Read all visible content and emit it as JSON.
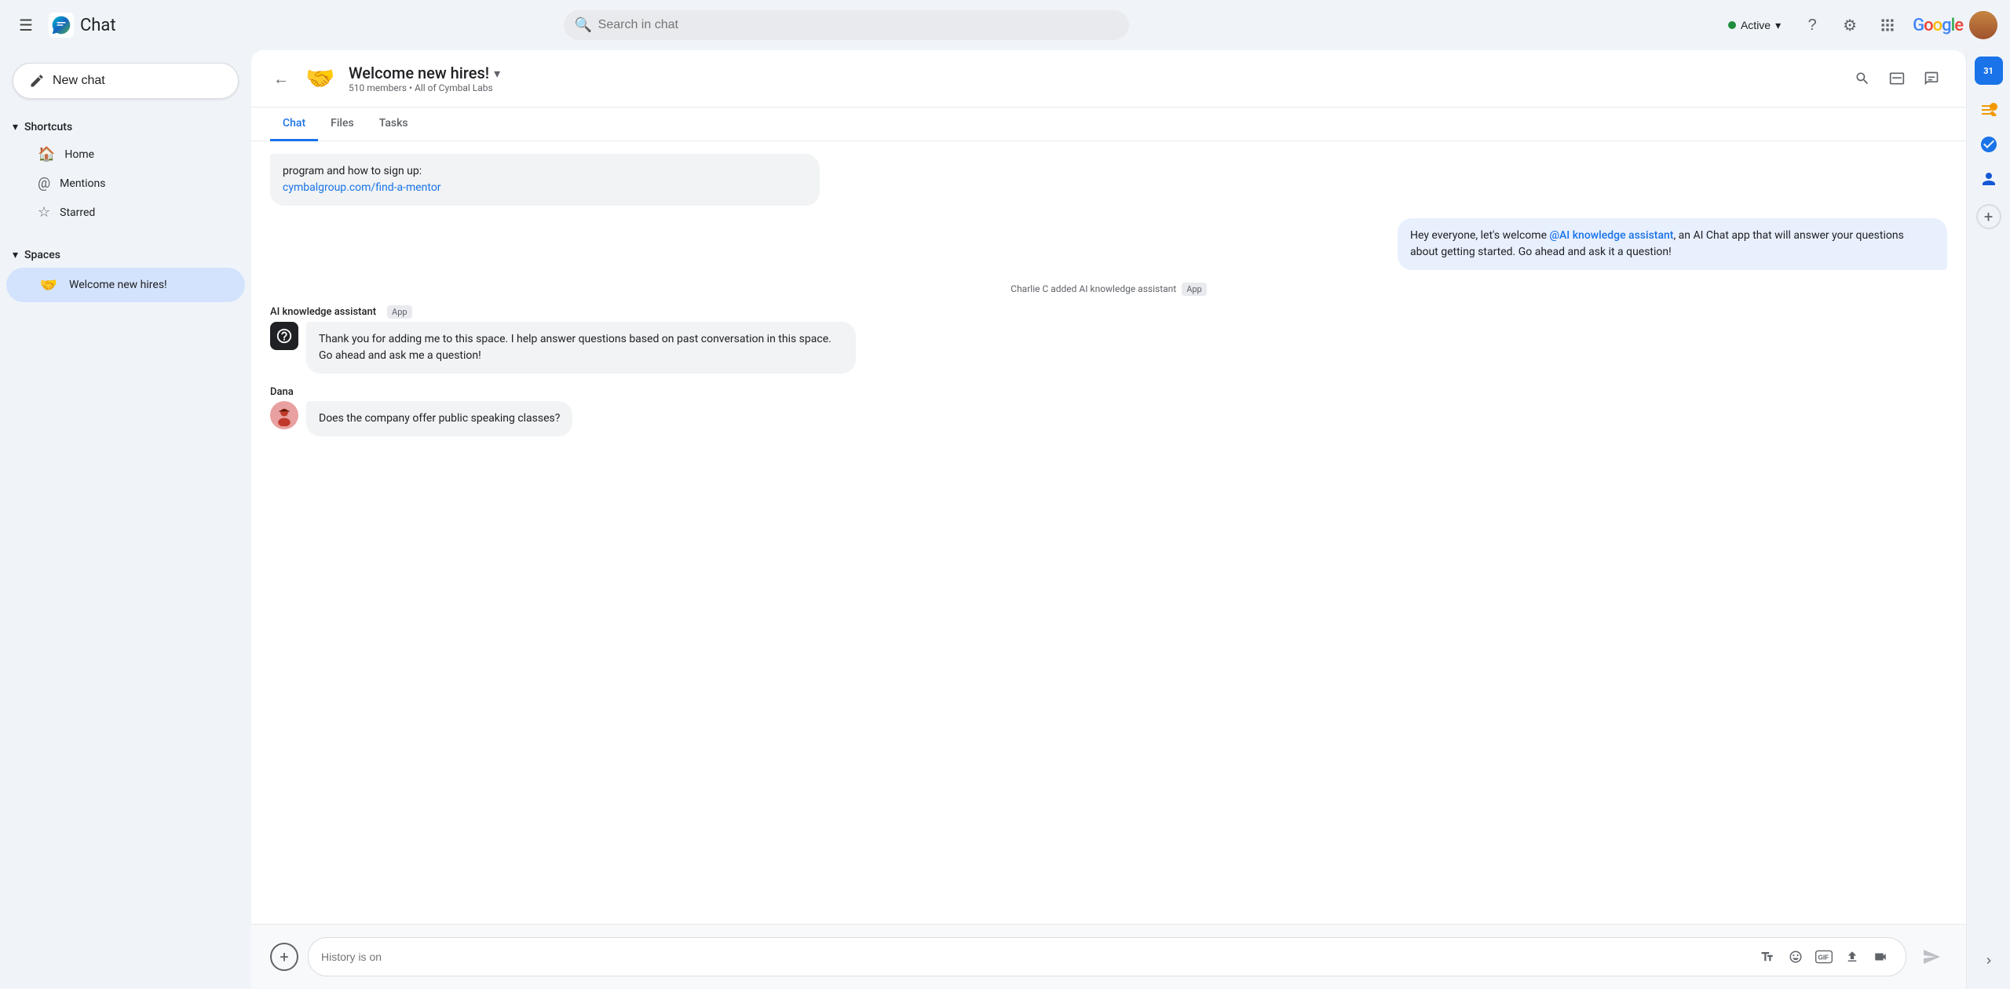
{
  "topbar": {
    "menu_icon": "☰",
    "app_title": "Chat",
    "search_placeholder": "Search in chat",
    "status_label": "Active",
    "status_color": "#1e8e3e",
    "help_icon": "?",
    "settings_icon": "⚙",
    "grid_icon": "⋮⋮⋮",
    "google_logo": "Google",
    "chevron_icon": "▾"
  },
  "sidebar": {
    "new_chat_label": "New chat",
    "shortcuts_label": "Shortcuts",
    "home_label": "Home",
    "mentions_label": "Mentions",
    "starred_label": "Starred",
    "spaces_label": "Spaces",
    "space_name": "Welcome new hires!",
    "space_emoji": "🤝"
  },
  "chat": {
    "back_icon": "←",
    "space_emoji": "🤝",
    "title": "Welcome new hires!",
    "title_chevron": "▾",
    "members_count": "510 members",
    "all_label": "All of Cymbal Labs",
    "tab_chat": "Chat",
    "tab_files": "Files",
    "tab_tasks": "Tasks"
  },
  "messages": [
    {
      "id": "msg1",
      "type": "partial_incoming",
      "text_partial": "program and how to sign up:",
      "link_text": "cymbalgroup.com/find-a-mentor",
      "link_href": "#"
    },
    {
      "id": "msg2",
      "type": "outgoing",
      "text": "Hey everyone, let's welcome @AI knowledge assistant, an AI Chat app that will answer your questions about getting started.  Go ahead and ask it a question!"
    },
    {
      "id": "sys1",
      "type": "system",
      "text": "Charlie C added AI knowledge assistant",
      "badge": "App"
    },
    {
      "id": "msg3",
      "type": "ai_message",
      "sender": "AI knowledge assistant",
      "sender_badge": "App",
      "avatar_type": "ai",
      "text": "Thank you for adding me to this space. I help answer questions based on past conversation in this space. Go ahead and ask me a question!"
    },
    {
      "id": "msg4",
      "type": "user_message",
      "sender": "Dana",
      "avatar_type": "dana",
      "text": "Does the company offer public speaking classes?"
    }
  ],
  "input_area": {
    "placeholder": "History is on",
    "add_icon": "+",
    "format_icon": "A",
    "emoji_icon": "☺",
    "gif_icon": "GIF",
    "upload_icon": "↑",
    "video_icon": "⊞",
    "send_icon": "▶"
  },
  "right_panel": {
    "calendar_icon": "31",
    "notes_icon": "●",
    "tasks_icon": "✓",
    "contacts_icon": "👤",
    "add_icon": "+",
    "expand_icon": "›"
  }
}
